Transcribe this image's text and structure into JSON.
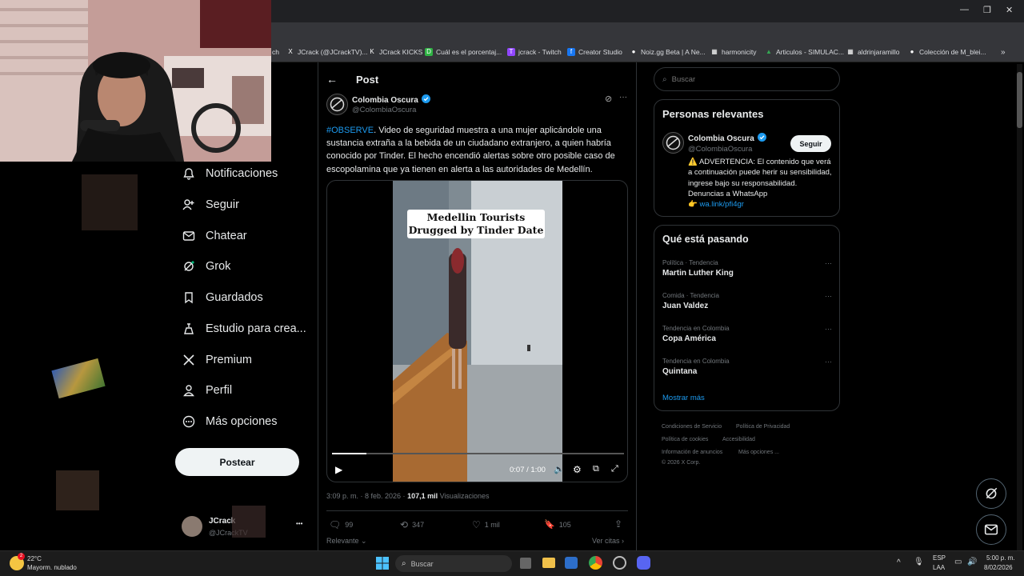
{
  "bookmarks": [
    {
      "label": "ch",
      "icon": "",
      "color": "#444"
    },
    {
      "label": "JCrack (@JCrackTV)...",
      "icon": "X",
      "color": "#000"
    },
    {
      "label": "JCrack KICKS",
      "icon": "K",
      "color": "#000"
    },
    {
      "label": "Cuál es el porcentaj...",
      "icon": "D",
      "color": "#2fb344"
    },
    {
      "label": "jcrack - Twitch",
      "icon": "T",
      "color": "#9146ff"
    },
    {
      "label": "Creator Studio",
      "icon": "f",
      "color": "#1877f2"
    },
    {
      "label": "Noiz.gg Beta | A Ne...",
      "icon": "●",
      "color": "#222"
    },
    {
      "label": "harmonicity",
      "icon": "▦",
      "color": "#555"
    },
    {
      "label": "Articulos - SIMULAC...",
      "icon": "▲",
      "color": "#34a853"
    },
    {
      "label": "aldrinjaramillo",
      "icon": "▦",
      "color": "#555"
    },
    {
      "label": "Colección de M_blei...",
      "icon": "●",
      "color": "#333"
    }
  ],
  "nav": [
    {
      "label": "Notificaciones",
      "icon": "bell-icon"
    },
    {
      "label": "Seguir",
      "icon": "follow-icon"
    },
    {
      "label": "Chatear",
      "icon": "mail-icon"
    },
    {
      "label": "Grok",
      "icon": "grok-icon"
    },
    {
      "label": "Guardados",
      "icon": "bookmark-icon"
    },
    {
      "label": "Estudio para crea...",
      "icon": "studio-icon"
    },
    {
      "label": "Premium",
      "icon": "x-icon"
    },
    {
      "label": "Perfil",
      "icon": "person-icon"
    },
    {
      "label": "Más opciones",
      "icon": "more-circle-icon"
    }
  ],
  "post_button": "Postear",
  "account": {
    "name": "JCrack",
    "handle": "@JCrackTV",
    "more": "•••"
  },
  "header": {
    "title": "Post"
  },
  "tweet": {
    "author_name": "Colombia Oscura",
    "author_handle": "@ColombiaOscura",
    "hashtag": "#OBSERVE",
    "text": ". Video de seguridad muestra a una mujer aplicándole una sustancia extraña a la bebida de un ciudadano extranjero, a quien habría conocido por Tinder. El hecho encendió alertas sobre otro posible caso de escopolamina que ya tienen en alerta a las autoridades de Medellín.",
    "video_caption_line1": "Medellin Tourists",
    "video_caption_line2": "Drugged by Tinder Date",
    "video_time": "0:07 / 1:00",
    "video_progress": 0.117,
    "meta_time": "3:09 p. m. · 8 feb. 2026 · ",
    "views_count": "107,1 mil",
    "views_label": " Visualizaciones",
    "replies": "99",
    "reposts": "347",
    "likes": "1 mil",
    "bookmarks": "105",
    "sort_label": "Relevante",
    "quotes_label": "Ver citas"
  },
  "search": {
    "placeholder": "Buscar"
  },
  "relevant": {
    "title": "Personas relevantes",
    "name": "Colombia Oscura",
    "handle": "@ColombiaOscura",
    "follow": "Seguir",
    "bio": "⚠️ ADVERTENCIA: El contenido que verá a continuación puede herir su sensibilidad, ingrese bajo su responsabilidad. Denuncias a WhatsApp",
    "link": "wa.link/pfi4gr"
  },
  "trends": {
    "title": "Qué está pasando",
    "items": [
      {
        "category": "Política · Tendencia",
        "name": "Martin Luther King"
      },
      {
        "category": "Comida · Tendencia",
        "name": "Juan Valdez"
      },
      {
        "category": "Tendencia en Colombia",
        "name": "Copa América"
      },
      {
        "category": "Tendencia en Colombia",
        "name": "Quintana"
      }
    ],
    "more": "Mostrar más"
  },
  "footer": {
    "l1": "Condiciones de Servicio",
    "l2": "Política de Privacidad",
    "l3": "Política de cookies",
    "l4": "Accesibilidad",
    "l5": "Información de anuncios",
    "l6": "Más opciones ...",
    "copy": "© 2026 X Corp."
  },
  "taskbar": {
    "temp": "22°C",
    "weather": "Mayorm. nublado",
    "weather_badge": "2",
    "search": "Buscar",
    "lang1": "ESP",
    "lang2": "LAA",
    "time": "5:00 p. m.",
    "date": "8/02/2026"
  },
  "colors": {
    "accent": "#1d9bf0",
    "bg": "#000000",
    "border": "#2f3336"
  }
}
